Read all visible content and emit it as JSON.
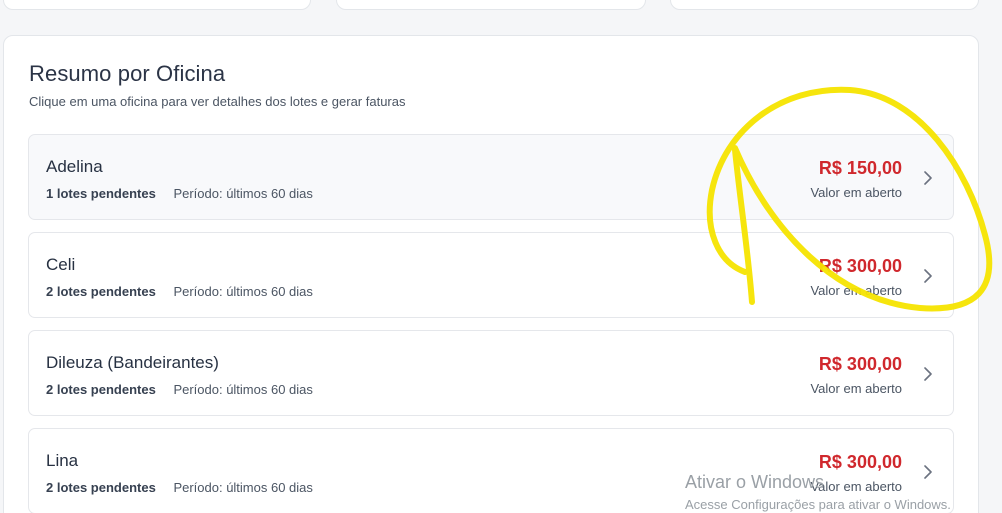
{
  "summary": {
    "title": "Resumo por Oficina",
    "subtitle": "Clique em uma oficina para ver detalhes dos lotes e gerar faturas",
    "rows": [
      {
        "name": "Adelina",
        "lots": "1 lotes pendentes",
        "period": "Período: últimos 60 dias",
        "value": "R$ 150,00",
        "value_label": "Valor em aberto"
      },
      {
        "name": "Celi",
        "lots": "2 lotes pendentes",
        "period": "Período: últimos 60 dias",
        "value": "R$ 300,00",
        "value_label": "Valor em aberto"
      },
      {
        "name": "Dileuza (Bandeirantes)",
        "lots": "2 lotes pendentes",
        "period": "Período: últimos 60 dias",
        "value": "R$ 300,00",
        "value_label": "Valor em aberto"
      },
      {
        "name": "Lina",
        "lots": "2 lotes pendentes",
        "period": "Período: últimos 60 dias",
        "value": "R$ 300,00",
        "value_label": "Valor em aberto"
      }
    ]
  },
  "watermark": {
    "title": "Ativar o Windows",
    "subtitle": "Acesse Configurações para ativar o Windows."
  },
  "colors": {
    "value_red": "#d0282d",
    "annotation_yellow": "#f5e400"
  },
  "icons": {
    "row_chevron": "chevron-right-icon"
  }
}
